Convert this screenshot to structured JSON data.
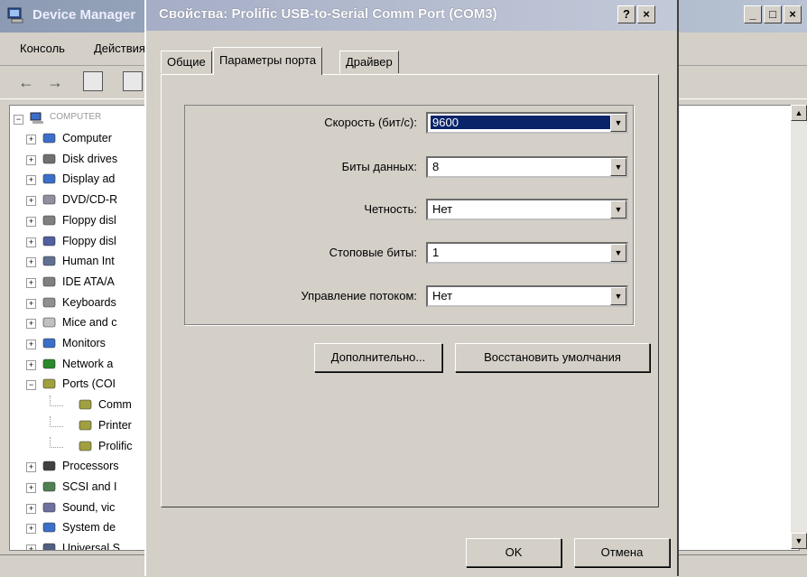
{
  "device_manager": {
    "title": "Device Manager",
    "menu": [
      "Консоль",
      "Действия"
    ],
    "tree_root": "COMPUTER",
    "tree": [
      {
        "label": "Computer",
        "icon": "computer-icon",
        "color": "#3a6ec8"
      },
      {
        "label": "Disk drives",
        "icon": "disk-drive-icon",
        "color": "#707070"
      },
      {
        "label": "Display ad",
        "icon": "display-adapter-icon",
        "color": "#3a6ec8"
      },
      {
        "label": "DVD/CD-R",
        "icon": "dvd-icon",
        "color": "#9090a0"
      },
      {
        "label": "Floppy disl",
        "icon": "floppy-controller-icon",
        "color": "#808080"
      },
      {
        "label": "Floppy disl",
        "icon": "floppy-drive-icon",
        "color": "#5060a0"
      },
      {
        "label": "Human Int",
        "icon": "hid-icon",
        "color": "#607090"
      },
      {
        "label": "IDE ATA/A",
        "icon": "ide-icon",
        "color": "#808080"
      },
      {
        "label": "Keyboards",
        "icon": "keyboard-icon",
        "color": "#909090"
      },
      {
        "label": "Mice and c",
        "icon": "mouse-icon",
        "color": "#c0c0c0"
      },
      {
        "label": "Monitors",
        "icon": "monitor-icon",
        "color": "#3a6ec8"
      },
      {
        "label": "Network a",
        "icon": "network-icon",
        "color": "#2a8a2a"
      },
      {
        "label": "Ports (COI",
        "icon": "port-icon",
        "color": "#a0a040"
      },
      {
        "label": "Comm",
        "icon": "port-icon",
        "color": "#a0a040"
      },
      {
        "label": "Printer",
        "icon": "port-icon",
        "color": "#a0a040"
      },
      {
        "label": "Prolific",
        "icon": "port-icon",
        "color": "#a0a040"
      },
      {
        "label": "Processors",
        "icon": "processor-icon",
        "color": "#404040"
      },
      {
        "label": "SCSI and I",
        "icon": "scsi-icon",
        "color": "#508050"
      },
      {
        "label": "Sound, vic",
        "icon": "sound-icon",
        "color": "#7070a0"
      },
      {
        "label": "System de",
        "icon": "system-icon",
        "color": "#3a6ec8"
      },
      {
        "label": "Universal S",
        "icon": "usb-icon",
        "color": "#506080"
      }
    ]
  },
  "dialog": {
    "title": "Свойства: Prolific USB-to-Serial Comm Port (COM3)",
    "help": "?",
    "close": "×",
    "tabs": [
      "Общие",
      "Параметры порта",
      "Драйвер"
    ],
    "fields": [
      {
        "label": "Скорость (бит/с):",
        "value": "9600"
      },
      {
        "label": "Биты данных:",
        "value": "8"
      },
      {
        "label": "Четность:",
        "value": "Нет"
      },
      {
        "label": "Стоповые биты:",
        "value": "1"
      },
      {
        "label": "Управление потоком:",
        "value": "Нет"
      }
    ],
    "advanced_button": "Дополнительно...",
    "restore_button": "Восстановить умолчания",
    "ok_button": "OK",
    "cancel_button": "Отмена"
  },
  "colors": {
    "dialog_title_bar": "#a5aec6",
    "selection": "#0a246a",
    "face": "#d4d0c8"
  }
}
